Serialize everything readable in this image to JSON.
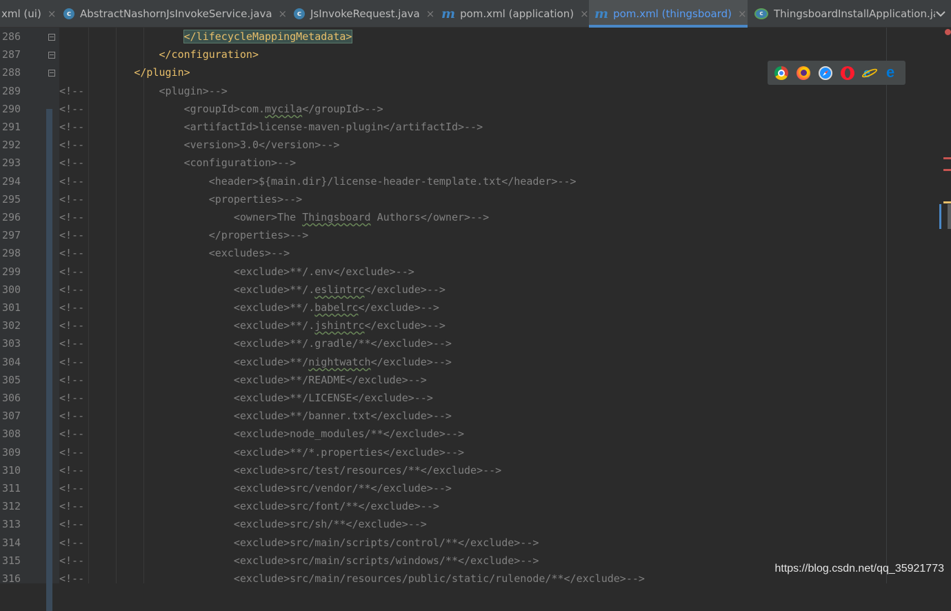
{
  "tabs": [
    {
      "label": "xml (ui)",
      "icon": "maven-icon",
      "active": false
    },
    {
      "label": "AbstractNashornJsInvokeService.java",
      "icon": "class-icon",
      "active": false
    },
    {
      "label": "JsInvokeRequest.java",
      "icon": "class-icon",
      "active": false
    },
    {
      "label": "pom.xml (application)",
      "icon": "maven-icon",
      "active": false
    },
    {
      "label": "pom.xml (thingsboard)",
      "icon": "maven-icon",
      "active": true
    },
    {
      "label": "ThingsboardInstallApplication.ja",
      "icon": "spring-app-icon",
      "active": false
    }
  ],
  "close_glyph": "×",
  "browser_icons": [
    "chrome-icon",
    "firefox-icon",
    "safari-icon",
    "opera-icon",
    "ie-icon",
    "edge-icon"
  ],
  "lines": [
    {
      "n": "286",
      "cm": "",
      "indent": "            ",
      "pre": "",
      "tag": "</lifecycleMappingMetadata>",
      "post": ""
    },
    {
      "n": "287",
      "cm": "",
      "indent": "        ",
      "pre": "",
      "tag": "</configuration>",
      "post": ""
    },
    {
      "n": "288",
      "cm": "",
      "indent": "    ",
      "pre": "",
      "tag": "</plugin>",
      "post": ""
    },
    {
      "n": "289",
      "cm": "<!--",
      "indent": "        ",
      "text": "<plugin>-->"
    },
    {
      "n": "290",
      "cm": "<!--",
      "indent": "            ",
      "text": "<groupId>com.mycila</groupId>-->"
    },
    {
      "n": "291",
      "cm": "<!--",
      "indent": "            ",
      "text": "<artifactId>license-maven-plugin</artifactId>-->"
    },
    {
      "n": "292",
      "cm": "<!--",
      "indent": "            ",
      "text": "<version>3.0</version>-->"
    },
    {
      "n": "293",
      "cm": "<!--",
      "indent": "            ",
      "text": "<configuration>-->"
    },
    {
      "n": "294",
      "cm": "<!--",
      "indent": "                ",
      "text": "<header>${main.dir}/license-header-template.txt</header>-->"
    },
    {
      "n": "295",
      "cm": "<!--",
      "indent": "                ",
      "text": "<properties>-->"
    },
    {
      "n": "296",
      "cm": "<!--",
      "indent": "                    ",
      "text": "<owner>The Thingsboard Authors</owner>-->"
    },
    {
      "n": "297",
      "cm": "<!--",
      "indent": "                ",
      "text": "</properties>-->"
    },
    {
      "n": "298",
      "cm": "<!--",
      "indent": "                ",
      "text": "<excludes>-->"
    },
    {
      "n": "299",
      "cm": "<!--",
      "indent": "                    ",
      "text": "<exclude>**/.env</exclude>-->"
    },
    {
      "n": "300",
      "cm": "<!--",
      "indent": "                    ",
      "text": "<exclude>**/.eslintrc</exclude>-->"
    },
    {
      "n": "301",
      "cm": "<!--",
      "indent": "                    ",
      "text": "<exclude>**/.babelrc</exclude>-->"
    },
    {
      "n": "302",
      "cm": "<!--",
      "indent": "                    ",
      "text": "<exclude>**/.jshintrc</exclude>-->"
    },
    {
      "n": "303",
      "cm": "<!--",
      "indent": "                    ",
      "text": "<exclude>**/.gradle/**</exclude>-->"
    },
    {
      "n": "304",
      "cm": "<!--",
      "indent": "                    ",
      "text": "<exclude>**/nightwatch</exclude>-->"
    },
    {
      "n": "305",
      "cm": "<!--",
      "indent": "                    ",
      "text": "<exclude>**/README</exclude>-->"
    },
    {
      "n": "306",
      "cm": "<!--",
      "indent": "                    ",
      "text": "<exclude>**/LICENSE</exclude>-->"
    },
    {
      "n": "307",
      "cm": "<!--",
      "indent": "                    ",
      "text": "<exclude>**/banner.txt</exclude>-->"
    },
    {
      "n": "308",
      "cm": "<!--",
      "indent": "                    ",
      "text": "<exclude>node_modules/**</exclude>-->"
    },
    {
      "n": "309",
      "cm": "<!--",
      "indent": "                    ",
      "text": "<exclude>**/*.properties</exclude>-->"
    },
    {
      "n": "310",
      "cm": "<!--",
      "indent": "                    ",
      "text": "<exclude>src/test/resources/**</exclude>-->"
    },
    {
      "n": "311",
      "cm": "<!--",
      "indent": "                    ",
      "text": "<exclude>src/vendor/**</exclude>-->"
    },
    {
      "n": "312",
      "cm": "<!--",
      "indent": "                    ",
      "text": "<exclude>src/font/**</exclude>-->"
    },
    {
      "n": "313",
      "cm": "<!--",
      "indent": "                    ",
      "text": "<exclude>src/sh/**</exclude>-->"
    },
    {
      "n": "314",
      "cm": "<!--",
      "indent": "                    ",
      "text": "<exclude>src/main/scripts/control/**</exclude>-->"
    },
    {
      "n": "315",
      "cm": "<!--",
      "indent": "                    ",
      "text": "<exclude>src/main/scripts/windows/**</exclude>-->"
    },
    {
      "n": "316",
      "cm": "<!--",
      "indent": "                    ",
      "text": "<exclude>src/main/resources/public/static/rulenode/**</exclude>-->"
    }
  ],
  "typos": [
    "mycila",
    "Thingsboard",
    "eslintrc",
    "babelrc",
    "jshintrc",
    "nightwatch"
  ],
  "watermark": "https://blog.csdn.net/qq_35921773",
  "colors": {
    "tag": "#e8bf6a",
    "comment": "#808080",
    "text": "#a9b7c6",
    "active_tab_accent": "#4a88c7",
    "error_marker": "#c75450",
    "warning_marker": "#e8bf6a"
  }
}
